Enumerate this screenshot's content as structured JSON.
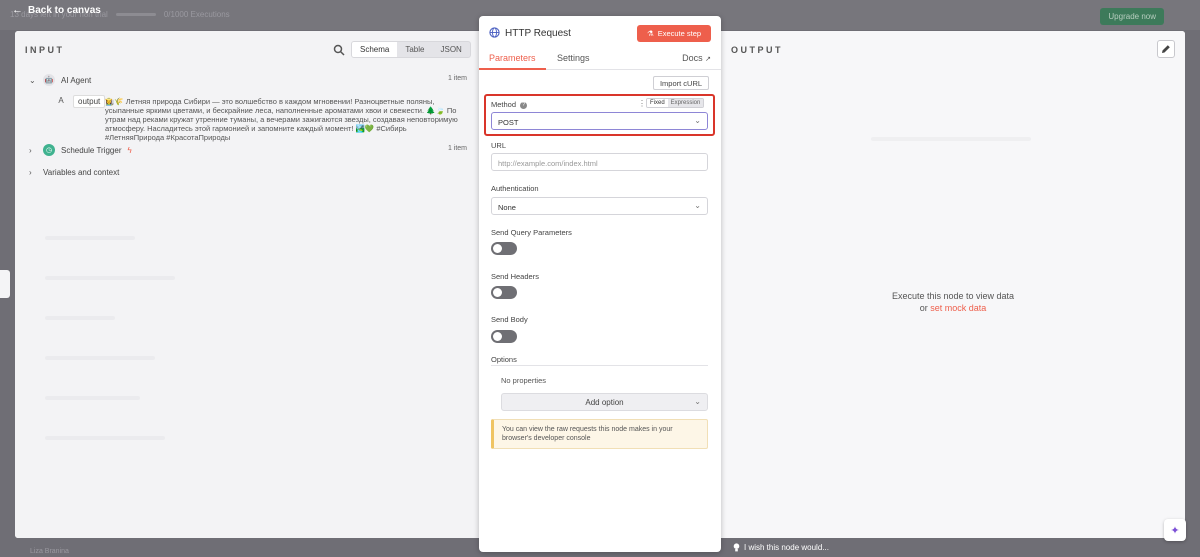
{
  "background": {
    "trial_text": "13 days left in your n8n trial",
    "executions": "0/1000 Executions",
    "upgrade_label": "Upgrade now",
    "user_name": "Liza Branina"
  },
  "nav": {
    "back_label": "Back to canvas"
  },
  "input_panel": {
    "title": "INPUT",
    "modes": [
      "Schema",
      "Table",
      "JSON"
    ],
    "active_mode": "Schema",
    "nodes": [
      {
        "label": "AI Agent",
        "count": "1 item",
        "icon": "robot-icon"
      },
      {
        "label": "Schedule Trigger",
        "count": "1 item",
        "icon": "clock-icon"
      }
    ],
    "field": {
      "type": "A",
      "name": "output",
      "value": "👩‍🌾🌾 Летняя природа Сибири — это волшебство в каждом мгновении! Разноцветные поляны, усыпанные яркими цветами, и бескрайние леса, наполненные ароматами хвои и свежести. 🌲🍃 По утрам над реками кружат утренние туманы, а вечерами зажигаются звезды, создавая неповторимую атмосферу. Насладитесь этой гармонией и запомните каждый момент! 🏞️💚 #Сибирь #ЛетняяПрирода #КрасотаПрироды"
    },
    "variables_label": "Variables and context"
  },
  "params_panel": {
    "node_title": "HTTP Request",
    "execute_label": "Execute step",
    "tabs": {
      "parameters": "Parameters",
      "settings": "Settings",
      "docs": "Docs"
    },
    "import_curl": "Import cURL",
    "method": {
      "label": "Method",
      "fixed": "Fixed",
      "expression": "Expression",
      "value": "POST"
    },
    "url": {
      "label": "URL",
      "placeholder": "http://example.com/index.html"
    },
    "authentication": {
      "label": "Authentication",
      "value": "None"
    },
    "send_query": {
      "label": "Send Query Parameters",
      "enabled": false
    },
    "send_headers": {
      "label": "Send Headers",
      "enabled": false
    },
    "send_body": {
      "label": "Send Body",
      "enabled": false
    },
    "options": {
      "label": "Options",
      "no_properties": "No properties",
      "add_option": "Add option"
    },
    "notice": "You can view the raw requests this node makes in your browser's developer console"
  },
  "output_panel": {
    "title": "OUTPUT",
    "message_line1": "Execute this node to view data",
    "message_or": "or",
    "mock_link": "set mock data"
  },
  "footer": {
    "wish_label": "I wish this node would..."
  },
  "colors": {
    "accent": "#ee5f4c",
    "highlight": "#d9352a"
  }
}
